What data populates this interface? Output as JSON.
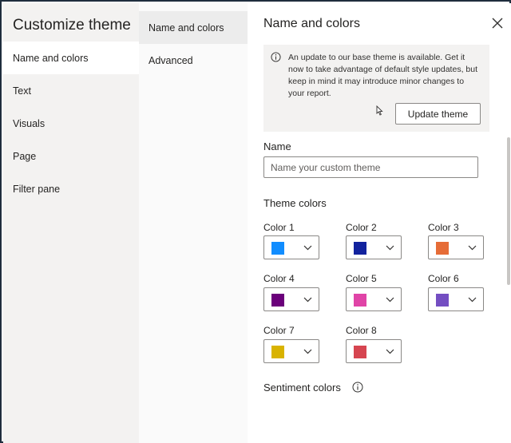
{
  "left_nav": {
    "title": "Customize theme",
    "items": [
      {
        "label": "Name and colors",
        "active": true
      },
      {
        "label": "Text",
        "active": false
      },
      {
        "label": "Visuals",
        "active": false
      },
      {
        "label": "Page",
        "active": false
      },
      {
        "label": "Filter pane",
        "active": false
      }
    ]
  },
  "sub_nav": {
    "items": [
      {
        "label": "Name and colors",
        "active": true
      },
      {
        "label": "Advanced",
        "active": false
      }
    ]
  },
  "panel": {
    "title": "Name and colors",
    "close_icon": "close-icon",
    "notice": {
      "icon": "info-icon",
      "text": "An update to our base theme is available. Get it now to take advantage of default style updates, but keep in mind it may introduce minor changes to your report.",
      "button_label": "Update theme"
    },
    "name_section": {
      "label": "Name",
      "placeholder": "Name your custom theme",
      "value": ""
    },
    "theme_colors": {
      "label": "Theme colors",
      "colors": [
        {
          "label": "Color 1",
          "hex": "#118dff"
        },
        {
          "label": "Color 2",
          "hex": "#12239e"
        },
        {
          "label": "Color 3",
          "hex": "#e66c37"
        },
        {
          "label": "Color 4",
          "hex": "#6b007b"
        },
        {
          "label": "Color 5",
          "hex": "#e044a7"
        },
        {
          "label": "Color 6",
          "hex": "#744ec2"
        },
        {
          "label": "Color 7",
          "hex": "#d9b300"
        },
        {
          "label": "Color 8",
          "hex": "#d64550"
        }
      ]
    },
    "sentiment_colors": {
      "label": "Sentiment colors",
      "icon": "info-icon"
    }
  }
}
